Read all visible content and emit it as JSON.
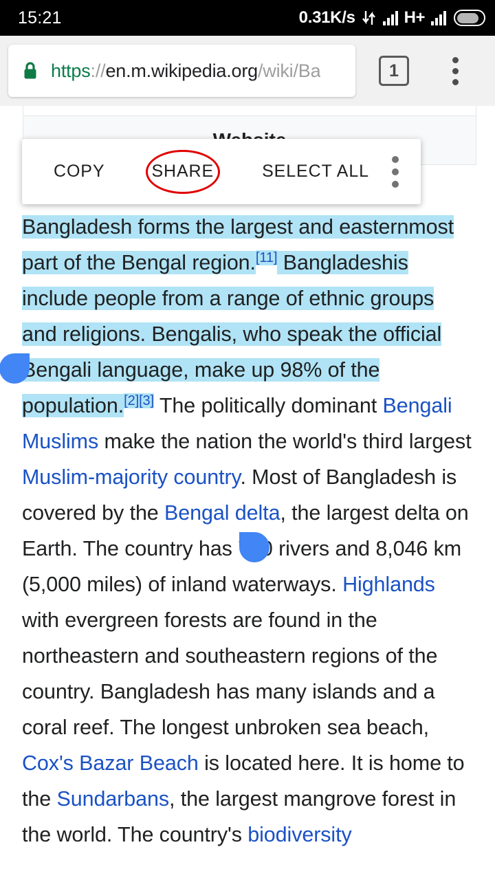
{
  "status_bar": {
    "clock": "15:21",
    "net_speed": "0.31K/s",
    "data_transfer_icon": "data-transfer-arrows-icon",
    "network_type": "H+",
    "signal_icon": "signal-bars-icon",
    "battery_icon": "battery-icon"
  },
  "browser": {
    "lock_icon": "secure-lock-icon",
    "url": {
      "scheme": "https",
      "separator": "://",
      "host": "en.m.wikipedia.org",
      "path": "/wiki/Ba",
      "full": "https://en.m.wikipedia.org/wiki/Ba"
    },
    "tab_count": "1",
    "menu_icon": "overflow-menu-icon",
    "colors": {
      "scheme_green": "#0b7b4b",
      "lock_green": "#0f7b44",
      "bar_background": "#f1f1f1"
    }
  },
  "infobox": {
    "section_header": "Website"
  },
  "selection_menu": {
    "copy_label": "COPY",
    "share_label": "SHARE",
    "select_all_label": "SELECT ALL",
    "overflow_icon": "overflow-menu-icon",
    "annotation": {
      "shape": "ellipse",
      "target": "SHARE",
      "color": "#e00000"
    }
  },
  "selection": {
    "highlight_color": "#b0e3f5",
    "handle_color": "#4285f4",
    "selected_text": "Bangladesh forms the largest and easternmost part of the Bengal region.[11] Bangladeshis include people from a range of ethnic groups and religions. Bengalis, who speak the official Bengali language, make up 98% of the population.[2][3]"
  },
  "article": {
    "link_color": "#1a52c4",
    "text_color": "#202122",
    "segments": [
      {
        "text": "Bangladesh forms the largest and easternmost part of the Bengal region.",
        "selected": true,
        "link": false
      },
      {
        "text": "[11]",
        "selected": true,
        "link": false,
        "reference": true
      },
      {
        "text": " Bangladeshis include people from a range of ethnic groups and religions. Bengalis, who speak the official Bengali language, make up 98% of the population.",
        "selected": true,
        "link": false
      },
      {
        "text": "[2][3]",
        "selected": true,
        "link": false,
        "reference": true
      },
      {
        "text": " The politically dominant ",
        "selected": false,
        "link": false
      },
      {
        "text": "Bengali Muslims",
        "selected": false,
        "link": true
      },
      {
        "text": " make the nation the world's third largest ",
        "selected": false,
        "link": false
      },
      {
        "text": "Muslim-majority country",
        "selected": false,
        "link": true
      },
      {
        "text": ". Most of Bangladesh is covered by the ",
        "selected": false,
        "link": false
      },
      {
        "text": "Bengal delta",
        "selected": false,
        "link": true
      },
      {
        "text": ", the largest delta on Earth. The country has 700 rivers and 8,046 km (5,000 miles) of inland waterways. ",
        "selected": false,
        "link": false
      },
      {
        "text": "Highlands",
        "selected": false,
        "link": true
      },
      {
        "text": " with evergreen forests are found in the northeastern and southeastern regions of the country. Bangladesh has many islands and a coral reef. The longest unbroken sea beach, ",
        "selected": false,
        "link": false
      },
      {
        "text": "Cox's Bazar Beach",
        "selected": false,
        "link": true
      },
      {
        "text": " is located here. It is home to the ",
        "selected": false,
        "link": false
      },
      {
        "text": "Sundarbans",
        "selected": false,
        "link": true
      },
      {
        "text": ", the largest mangrove forest in the world. The country's ",
        "selected": false,
        "link": false
      },
      {
        "text": "biodiversity",
        "selected": false,
        "link": true
      }
    ]
  }
}
